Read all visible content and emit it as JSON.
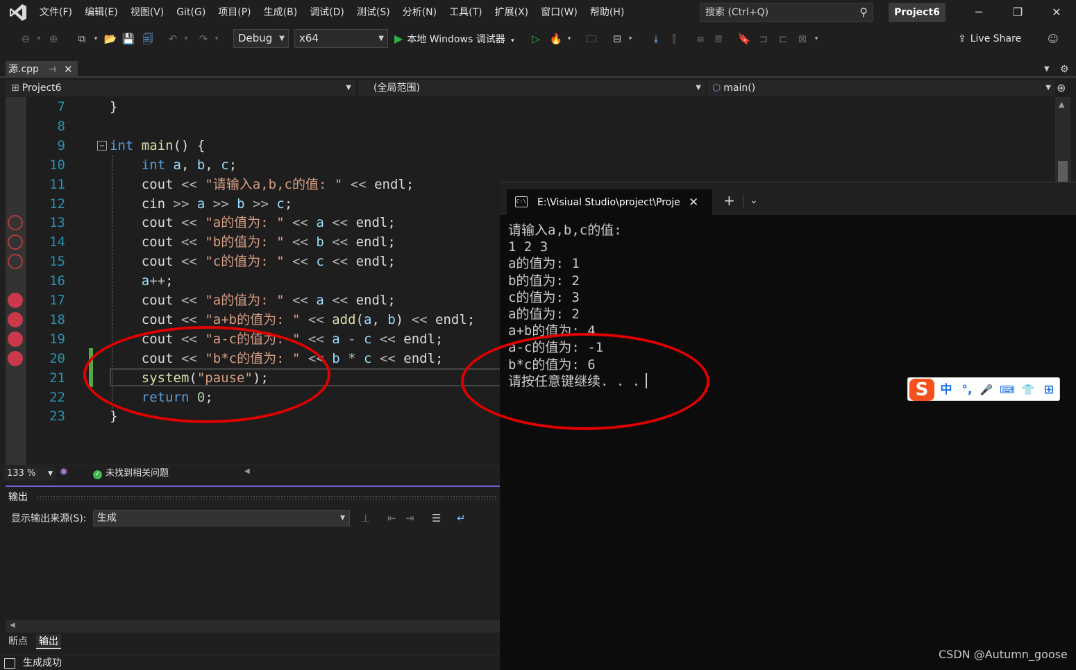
{
  "menubar": {
    "items": [
      "文件(F)",
      "编辑(E)",
      "视图(V)",
      "Git(G)",
      "项目(P)",
      "生成(B)",
      "调试(D)",
      "测试(S)",
      "分析(N)",
      "工具(T)",
      "扩展(X)",
      "窗口(W)",
      "帮助(H)"
    ],
    "search_label": "搜索 (Ctrl+Q)",
    "project_name": "Project6"
  },
  "toolbar": {
    "config": "Debug",
    "platform": "x64",
    "debug_target": "本地 Windows 调试器",
    "live_share": "Live Share"
  },
  "document_tab": {
    "name": "源.cpp"
  },
  "navbar": {
    "project": "Project6",
    "scope": "(全局范围)",
    "member": "main()"
  },
  "editor": {
    "lines": [
      {
        "n": "7",
        "code": "}"
      },
      {
        "n": "8",
        "code": ""
      },
      {
        "n": "9",
        "code": "int main() {"
      },
      {
        "n": "10",
        "code": "    int a, b, c;"
      },
      {
        "n": "11",
        "code": "    cout << \"请输入a,b,c的值: \" << endl;"
      },
      {
        "n": "12",
        "code": "    cin >> a >> b >> c;"
      },
      {
        "n": "13",
        "code": "    cout << \"a的值为: \" << a << endl;"
      },
      {
        "n": "14",
        "code": "    cout << \"b的值为: \" << b << endl;"
      },
      {
        "n": "15",
        "code": "    cout << \"c的值为: \" << c << endl;"
      },
      {
        "n": "16",
        "code": "    a++;"
      },
      {
        "n": "17",
        "code": "    cout << \"a的值为: \" << a << endl;"
      },
      {
        "n": "18",
        "code": "    cout << \"a+b的值为: \" << add(a, b) << endl;"
      },
      {
        "n": "19",
        "code": "    cout << \"a-c的值为: \" << a - c << endl;"
      },
      {
        "n": "20",
        "code": "    cout << \"b*c的值为: \" << b * c << endl;"
      },
      {
        "n": "21",
        "code": "    system(\"pause\");"
      },
      {
        "n": "22",
        "code": "    return 0;"
      },
      {
        "n": "23",
        "code": "}"
      }
    ],
    "zoom": "133 %",
    "issues": "未找到相关问题"
  },
  "output_panel": {
    "title": "输出",
    "source_label": "显示输出来源(S):",
    "source_value": "生成"
  },
  "bottom_tabs": [
    "断点",
    "输出"
  ],
  "status": {
    "message": "生成成功"
  },
  "console": {
    "title": "E:\\Visiual Studio\\project\\Proje",
    "lines": [
      "请输入a,b,c的值:",
      "1 2 3",
      "a的值为: 1",
      "b的值为: 2",
      "c的值为: 3",
      "a的值为: 2",
      "a+b的值为: 4",
      "a-c的值为: -1",
      "b*c的值为: 6",
      "请按任意键继续. . ."
    ]
  },
  "ime": {
    "logo": "S",
    "buttons": [
      "中",
      "°,",
      "🎤",
      "⌨",
      "👕",
      "⊞"
    ]
  },
  "watermark": "CSDN @Autumn_goose"
}
